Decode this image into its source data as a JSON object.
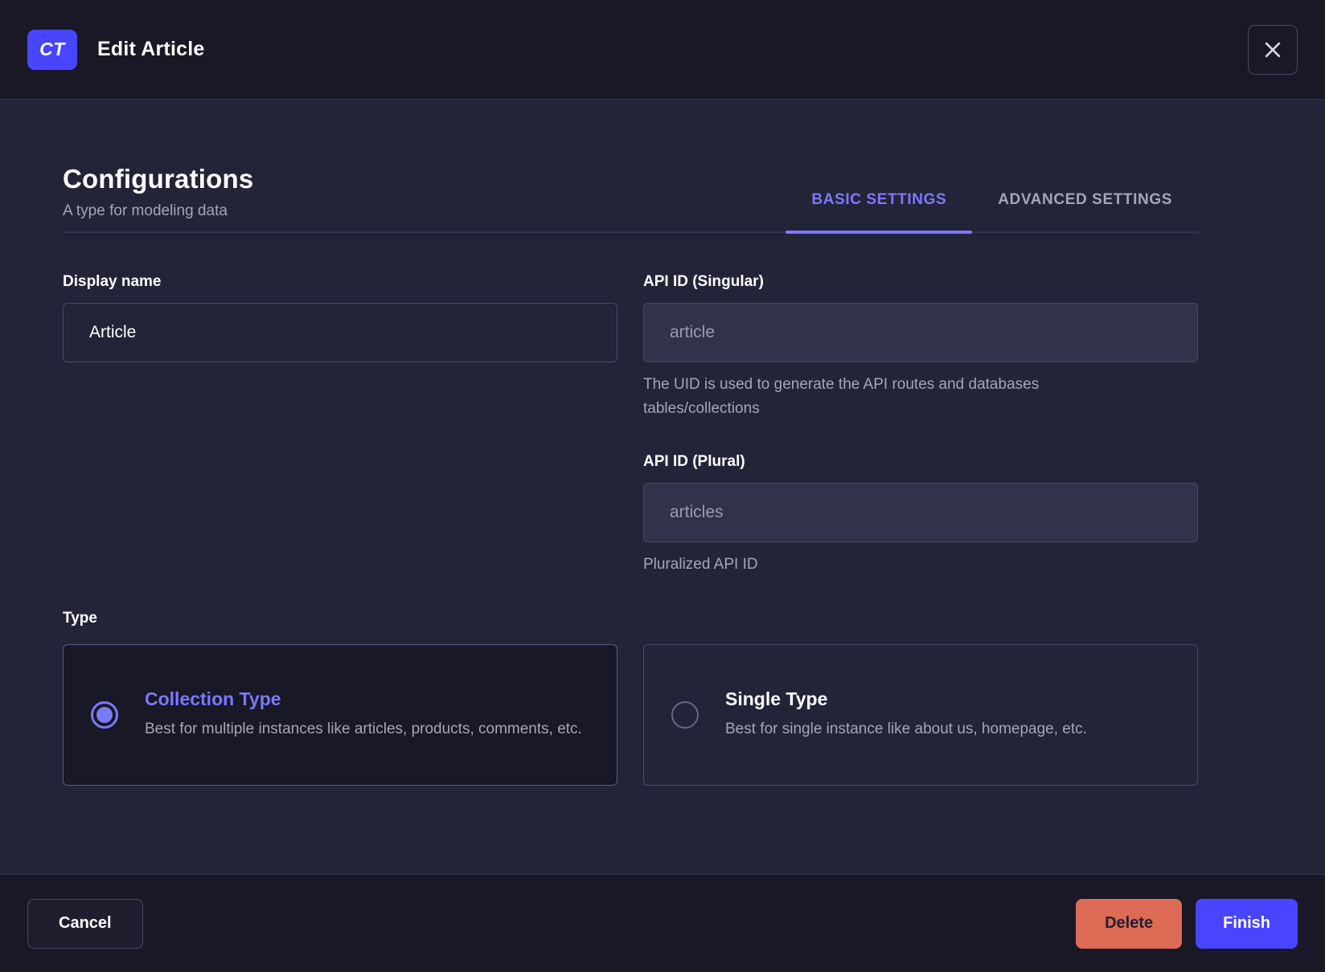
{
  "header": {
    "badge_label": "CT",
    "title": "Edit Article"
  },
  "configurations": {
    "title": "Configurations",
    "subtitle": "A type for modeling data",
    "tabs": [
      {
        "label": "BASIC SETTINGS",
        "active": true
      },
      {
        "label": "ADVANCED SETTINGS",
        "active": false
      }
    ]
  },
  "form": {
    "display_name": {
      "label": "Display name",
      "value": "Article"
    },
    "api_id_singular": {
      "label": "API ID (Singular)",
      "value": "article",
      "hint": "The UID is used to generate the API routes and databases tables/collections"
    },
    "api_id_plural": {
      "label": "API ID (Plural)",
      "value": "articles",
      "hint": "Pluralized API ID"
    },
    "type": {
      "label": "Type",
      "options": [
        {
          "title": "Collection Type",
          "description": "Best for multiple instances like articles, products, comments, etc.",
          "selected": true
        },
        {
          "title": "Single Type",
          "description": "Best for single instance like about us, homepage, etc.",
          "selected": false
        }
      ]
    }
  },
  "footer": {
    "cancel_label": "Cancel",
    "delete_label": "Delete",
    "finish_label": "Finish"
  },
  "colors": {
    "primary": "#4945ff",
    "primary_light": "#7b79ff",
    "danger": "#dd6b56",
    "header_bg": "#181826",
    "body_bg": "#242438"
  }
}
